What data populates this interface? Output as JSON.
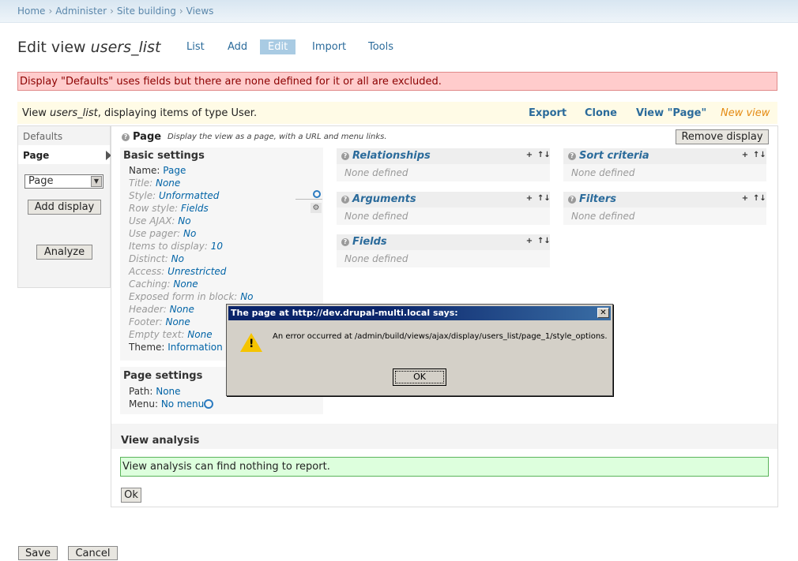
{
  "breadcrumb": [
    "Home",
    "Administer",
    "Site building",
    "Views"
  ],
  "breadcrumb_sep": "›",
  "page_title": {
    "prefix": "Edit view",
    "name": "users_list"
  },
  "tabs": [
    {
      "label": "List",
      "active": false
    },
    {
      "label": "Add",
      "active": false
    },
    {
      "label": "Edit",
      "active": true
    },
    {
      "label": "Import",
      "active": false
    },
    {
      "label": "Tools",
      "active": false
    }
  ],
  "error_message": "Display \"Defaults\" uses fields but there are none defined for it or all are excluded.",
  "view_bar": {
    "pre": "View",
    "name": "users_list",
    "post": ", displaying items of type User.",
    "actions": [
      "Export",
      "Clone",
      "View \"Page\"",
      "New view"
    ]
  },
  "displays": {
    "items": [
      "Defaults",
      "Page"
    ],
    "selected": "Page",
    "select_value": "Page",
    "add_display_label": "Add display",
    "analyze_label": "Analyze"
  },
  "display_header": {
    "name": "Page",
    "description": "Display the view as a page, with a URL and menu links.",
    "remove_label": "Remove display"
  },
  "basic_settings": {
    "title": "Basic settings",
    "rows": [
      {
        "key": "Name:",
        "value": "Page",
        "dim": false
      },
      {
        "key": "Title:",
        "value": "None",
        "dim": true
      },
      {
        "key": "Style:",
        "value": "Unformatted",
        "dim": true
      },
      {
        "key": "Row style:",
        "value": "Fields",
        "dim": true
      },
      {
        "key": "Use AJAX:",
        "value": "No",
        "dim": true
      },
      {
        "key": "Use pager:",
        "value": "No",
        "dim": true
      },
      {
        "key": "Items to display:",
        "value": "10",
        "dim": true
      },
      {
        "key": "Distinct:",
        "value": "No",
        "dim": true
      },
      {
        "key": "Access:",
        "value": "Unrestricted",
        "dim": true
      },
      {
        "key": "Caching:",
        "value": "None",
        "dim": true
      },
      {
        "key": "Exposed form in block:",
        "value": "No",
        "dim": true
      },
      {
        "key": "Header:",
        "value": "None",
        "dim": true
      },
      {
        "key": "Footer:",
        "value": "None",
        "dim": true
      },
      {
        "key": "Empty text:",
        "value": "None",
        "dim": true
      },
      {
        "key": "Theme:",
        "value": "Information",
        "dim": false
      }
    ]
  },
  "page_settings": {
    "title": "Page settings",
    "rows": [
      {
        "key": "Path:",
        "value": "None"
      },
      {
        "key": "Menu:",
        "value": "No menu"
      }
    ]
  },
  "panels": {
    "relationships": {
      "title": "Relationships",
      "empty": "None defined"
    },
    "arguments": {
      "title": "Arguments",
      "empty": "None defined"
    },
    "fields": {
      "title": "Fields",
      "empty": "None defined"
    },
    "sort_criteria": {
      "title": "Sort criteria",
      "empty": "None defined"
    },
    "filters": {
      "title": "Filters",
      "empty": "None defined"
    }
  },
  "panel_controls": {
    "add": "+",
    "rearrange": "↑↓"
  },
  "help_glyph": "?",
  "analysis": {
    "title": "View analysis",
    "message": "View analysis can find nothing to report.",
    "ok_label": "Ok"
  },
  "dialog": {
    "title": "The page at http://dev.drupal-multi.local says:",
    "message": "An error occurred at /admin/build/views/ajax/display/users_list/page_1/style_options.",
    "ok_label": "OK",
    "close_glyph": "✕",
    "warning_glyph": "!"
  },
  "footer_buttons": {
    "save": "Save",
    "cancel": "Cancel"
  },
  "colors": {
    "link": "#0063a6",
    "error_bg": "#ffcccc",
    "ok_bg": "#ddffdd",
    "new_view": "#e48a12",
    "tab_active": "#a9cbe3"
  }
}
